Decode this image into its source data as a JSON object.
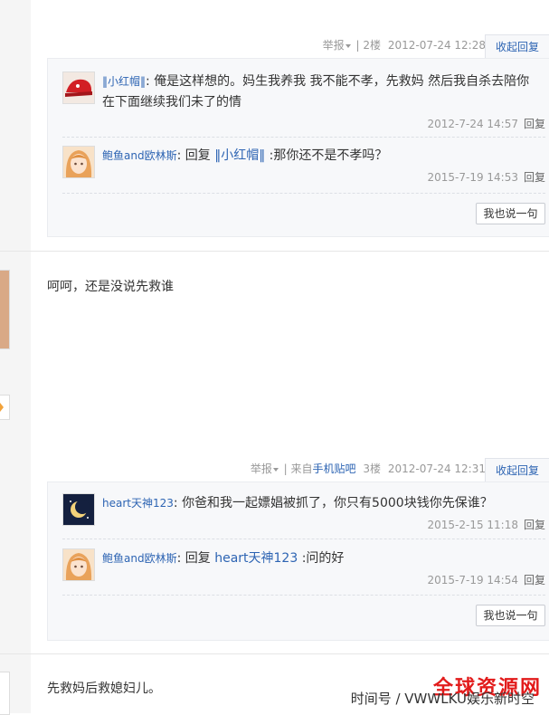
{
  "posts": [
    {
      "meta": {
        "report": "举报",
        "sep": "|",
        "floor": "2楼",
        "date": "2012-07-24 12:28",
        "client_prefix": "",
        "client": ""
      },
      "collapse_label": "收起回复",
      "replies": [
        {
          "user": "‖小红帽‖",
          "text": "俺是这样想的。妈生我养我 我不能不孝，先救妈 然后我自杀去陪你 在下面继续我们未了的情",
          "time": "2012-7-24 14:57",
          "reply_label": "回复",
          "avatar_icon": "red-hat-avatar"
        },
        {
          "user": "鲍鱼and欧林斯",
          "prefix": "回复",
          "target": "‖小红帽‖",
          "text": ":那你还不是不孝吗？",
          "time": "2015-7-19 14:53",
          "reply_label": "回复",
          "avatar_icon": "girl-avatar"
        }
      ],
      "say_button": "我也说一句"
    },
    {
      "content": "呵呵，还是没说先救谁",
      "meta": {
        "report": "举报",
        "sep": "|",
        "client_prefix": "来自",
        "client": "手机贴吧",
        "floor": "3楼",
        "date": "2012-07-24 12:31"
      },
      "collapse_label": "收起回复",
      "replies": [
        {
          "user": "heart天神123",
          "text": "你爸和我一起嫖娼被抓了，你只有5000块钱你先保谁？",
          "time": "2015-2-15 11:18",
          "reply_label": "回复",
          "avatar_icon": "moon-avatar"
        },
        {
          "user": "鲍鱼and欧林斯",
          "prefix": "回复",
          "target": "heart天神123",
          "text": ":问的好",
          "time": "2015-7-19 14:54",
          "reply_label": "回复",
          "avatar_icon": "girl-avatar"
        }
      ],
      "say_button": "我也说一句"
    },
    {
      "content": "先救妈后救媳妇儿。"
    }
  ],
  "watermark": {
    "line1": "全球资源网",
    "line2": "时间号 / VWWLKU娱乐新时空"
  }
}
